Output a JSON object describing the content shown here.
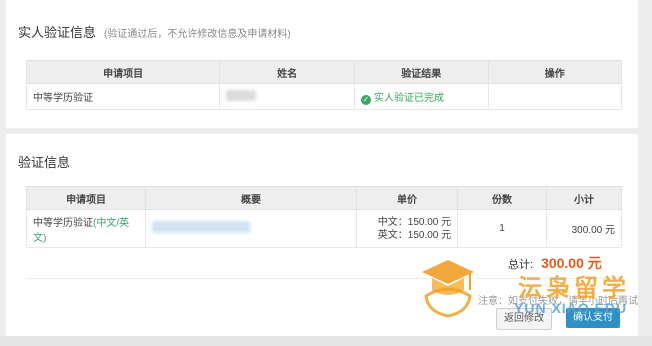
{
  "verify_info": {
    "title": "实人验证信息",
    "hint": "(验证通过后，不允许修改信息及申请材料)",
    "columns": [
      "申请项目",
      "姓名",
      "验证结果",
      "操作"
    ],
    "row": {
      "item": "中等学历验证",
      "result": "实人验证已完成"
    }
  },
  "validation_info": {
    "title": "验证信息",
    "columns": [
      "申请项目",
      "概要",
      "单价",
      "份数",
      "小计"
    ],
    "row": {
      "item_prefix": "中等学历验证",
      "item_suffix": "(中文/英文)",
      "price_cn": "中文：150.00 元",
      "price_en": "英文：150.00 元",
      "quantity": "1",
      "subtotal": "300.00 元"
    },
    "total_label": "总计:",
    "total_amount": "300.00 元",
    "note": "注意：如支付失败，请半小时后再试",
    "back_button": "返回修改",
    "pay_button": "确认支付"
  },
  "watermark": {
    "cn": "沄枭留学",
    "en": "YUN XIAO EDU"
  },
  "colors": {
    "accent_orange": "#e8591a",
    "success_green": "#3aa463",
    "primary_blue": "#2f90c6",
    "watermark_orange": "#f0a028"
  }
}
